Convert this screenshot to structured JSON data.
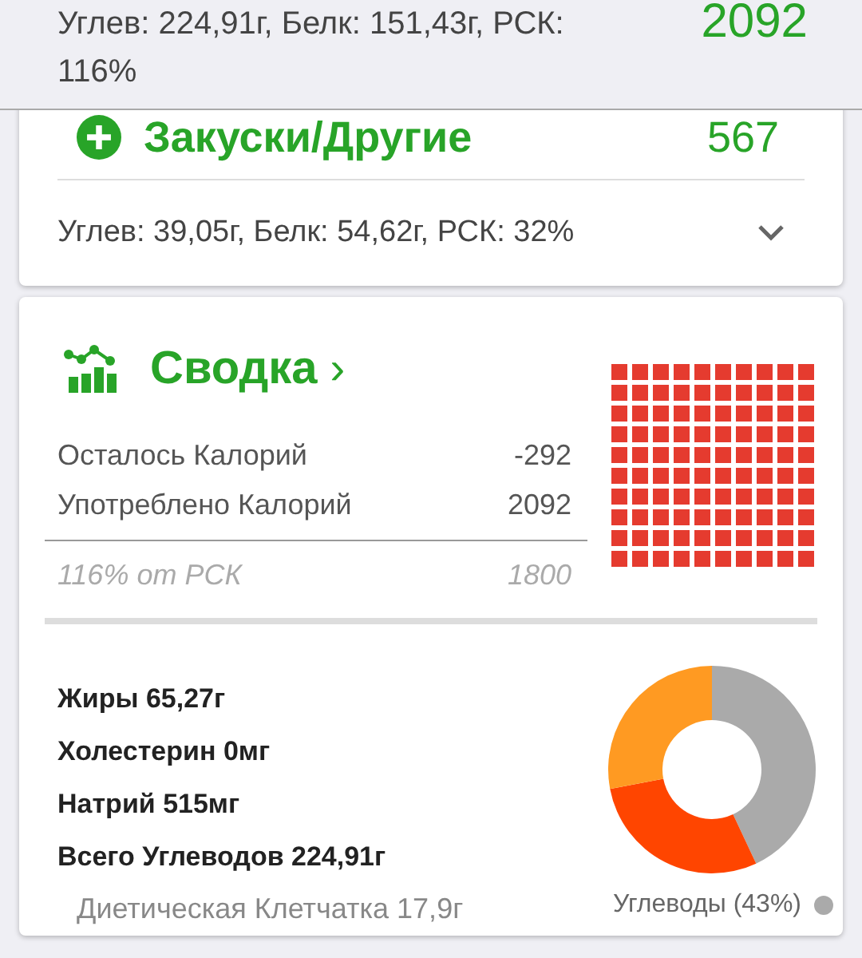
{
  "header": {
    "macros": "Углев: 224,91г, Белк: 151,43г, РСК: 116%",
    "calories": "2092"
  },
  "meal_card": {
    "title": "Закуски/Другие",
    "calories": "567",
    "macros": "Углев: 39,05г, Белк: 54,62г, РСК: 32%",
    "expanded": false
  },
  "summary": {
    "title": "Сводка",
    "chevron": "›",
    "rows": [
      {
        "label": "Осталось Калорий",
        "value": "-292"
      },
      {
        "label": "Употреблено Калорий",
        "value": "2092"
      }
    ],
    "goal": {
      "label": "116% от РСК",
      "value": "1800"
    },
    "waffle": {
      "level": 1
    },
    "nutrients": [
      {
        "kind": "main",
        "text": "Жиры 65,27г"
      },
      {
        "kind": "main",
        "text": "Холестерин 0мг"
      },
      {
        "kind": "main",
        "text": "Натрий 515мг"
      },
      {
        "kind": "main",
        "text": "Всего Углеводов 224,91г"
      },
      {
        "kind": "sub",
        "text": "Диетическая Клетчатка 17,9г"
      }
    ],
    "legend": [
      {
        "label": "Углеводы (43%)",
        "color": "#aaaaaa"
      }
    ]
  }
}
